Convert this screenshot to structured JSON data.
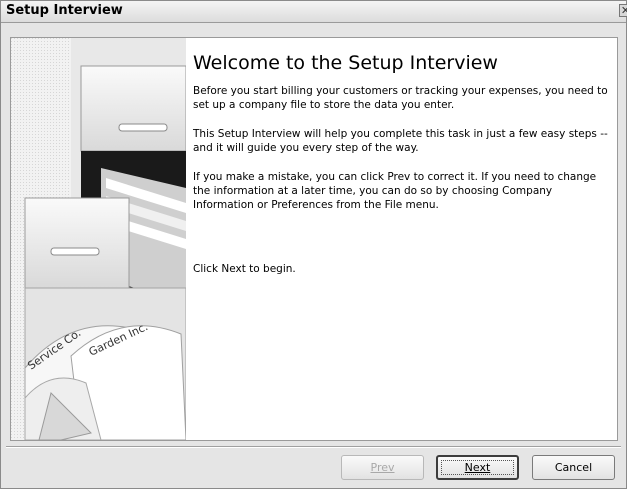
{
  "window": {
    "title": "Setup Interview",
    "close_glyph": "✕"
  },
  "art": {
    "card_1": "Service Co.",
    "card_2": "Garden Inc."
  },
  "content": {
    "heading": "Welcome to the Setup Interview",
    "para1": "Before you start billing your customers or tracking your expenses, you need to set up a company file to store the data you enter.",
    "para2": "This Setup Interview will help you complete this task in just a few easy steps -- and it will guide you every step of the way.",
    "para3": "If you make a mistake, you can click Prev to correct it. If you need to change the information at a later time, you can do so by choosing Company Information or Preferences from the File menu.",
    "para4": "Click Next to begin."
  },
  "buttons": {
    "prev": {
      "label": "Prev",
      "enabled": false
    },
    "next": {
      "label": "Next",
      "default": true
    },
    "cancel": {
      "label": "Cancel"
    }
  }
}
